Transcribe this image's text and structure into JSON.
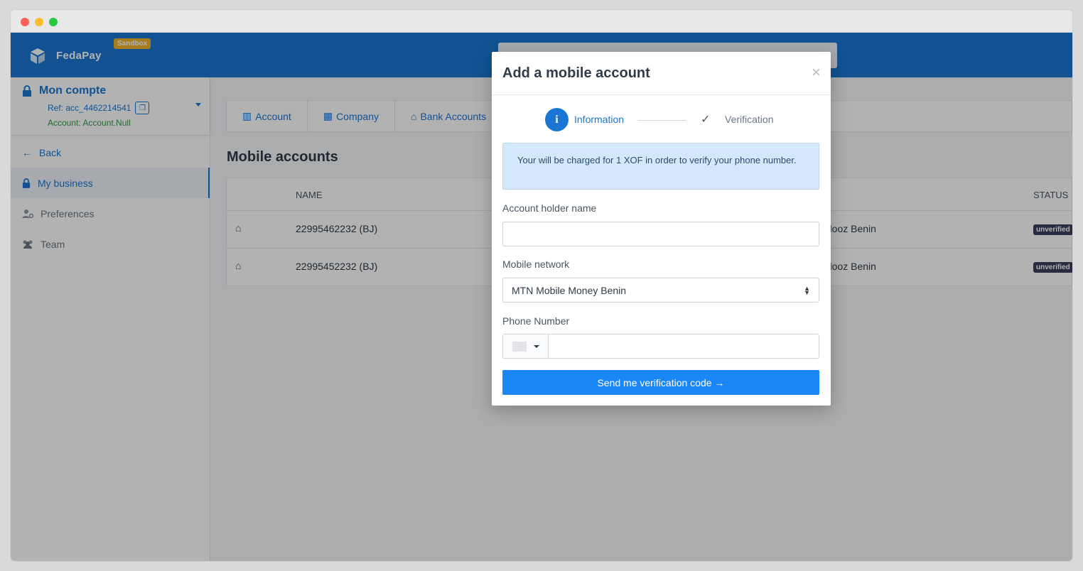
{
  "brand": {
    "name": "FedaPay",
    "badge": "Sandbox"
  },
  "account": {
    "title": "Mon compte",
    "ref": "Ref: acc_4462214541",
    "account_line": "Account: Account.Null"
  },
  "sidebar": {
    "back": "Back",
    "items": [
      {
        "label": "My business",
        "icon": "lock-icon"
      },
      {
        "label": "Preferences",
        "icon": "user-gear-icon"
      },
      {
        "label": "Team",
        "icon": "team-icon"
      }
    ]
  },
  "tabs": [
    {
      "label": "Account",
      "icon": "building-icon"
    },
    {
      "label": "Company",
      "icon": "company-icon"
    },
    {
      "label": "Bank Accounts",
      "icon": "bank-icon"
    }
  ],
  "page": {
    "title": "Mobile accounts"
  },
  "table": {
    "columns": [
      "NAME",
      "STATUS"
    ],
    "rows": [
      {
        "name": "22995462232 (BJ)",
        "network": "Flooz Benin",
        "status": "unverified"
      },
      {
        "name": "22995452232 (BJ)",
        "network": "Flooz Benin",
        "status": "unverified"
      }
    ]
  },
  "modal": {
    "title": "Add a mobile account",
    "close": "×",
    "steps": [
      {
        "label": "Information",
        "marker": "i"
      },
      {
        "label": "Verification",
        "marker": "✓"
      }
    ],
    "alert": "Your will be charged for 1 XOF in order to verify your phone number.",
    "fields": {
      "holder_label": "Account holder name",
      "holder_value": "",
      "network_label": "Mobile network",
      "network_value": "MTN Mobile Money Benin",
      "phone_label": "Phone Number",
      "phone_value": ""
    },
    "submit": "Send me verification code",
    "submit_arrow": "→"
  },
  "colors": {
    "primary": "#1a76d2",
    "button": "#1b86f5",
    "badge": "#3b3f5c",
    "sandbox": "#f0b429"
  }
}
